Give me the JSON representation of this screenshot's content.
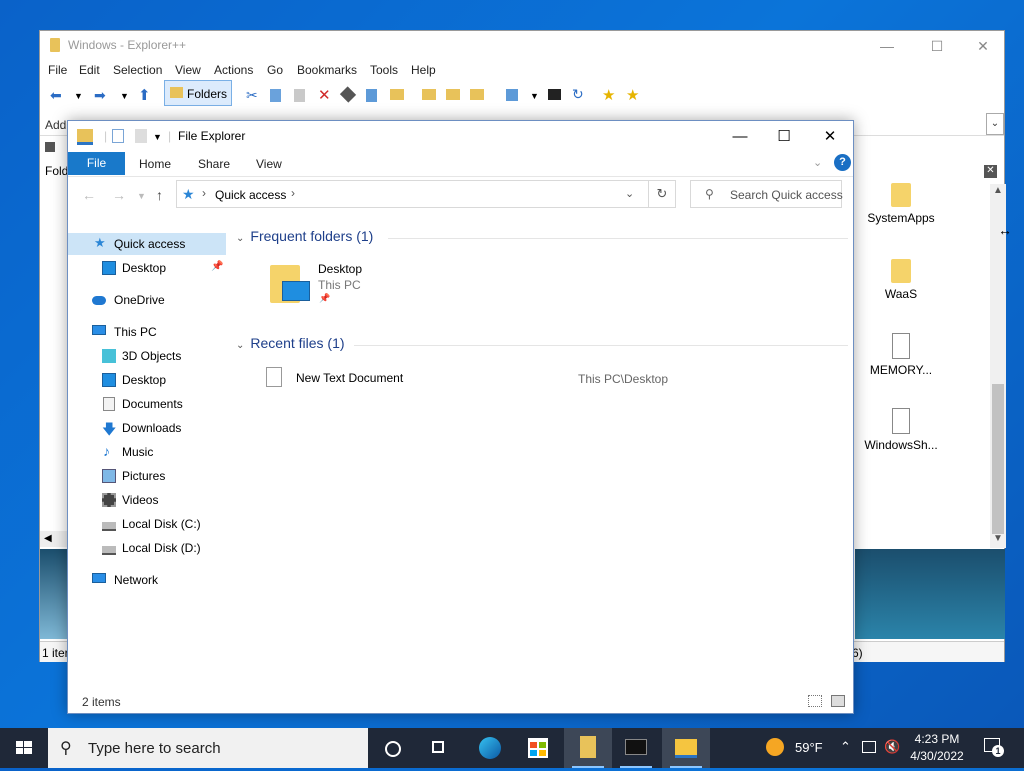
{
  "explorerpp": {
    "title": "Windows - Explorer++",
    "menu": [
      "File",
      "Edit",
      "Selection",
      "View",
      "Actions",
      "Go",
      "Bookmarks",
      "Tools",
      "Help"
    ],
    "folders_button": "Folders",
    "address_label": "Add",
    "tree_label": "Fold",
    "items": [
      "SystemApps",
      "WaaS",
      "MEMORY...",
      "WindowsSh..."
    ],
    "status_left": "1 iter",
    "status_right": "6)"
  },
  "file_explorer": {
    "title": "File Explorer",
    "ribbon": {
      "file": "File",
      "tabs": [
        "Home",
        "Share",
        "View"
      ],
      "help": "?"
    },
    "address": {
      "path": "Quick access",
      "search_placeholder": "Search Quick access"
    },
    "nav": [
      {
        "label": "Quick access",
        "icon": "star-icon"
      },
      {
        "label": "Desktop",
        "icon": "desktop-icon",
        "pinned": true
      },
      {
        "label": "OneDrive",
        "icon": "cloud-icon"
      },
      {
        "label": "This PC",
        "icon": "computer-icon"
      },
      {
        "label": "3D Objects",
        "icon": "cube-icon"
      },
      {
        "label": "Desktop",
        "icon": "desktop-icon"
      },
      {
        "label": "Documents",
        "icon": "document-icon"
      },
      {
        "label": "Downloads",
        "icon": "download-icon"
      },
      {
        "label": "Music",
        "icon": "music-icon"
      },
      {
        "label": "Pictures",
        "icon": "pictures-icon"
      },
      {
        "label": "Videos",
        "icon": "video-icon"
      },
      {
        "label": "Local Disk (C:)",
        "icon": "drive-icon"
      },
      {
        "label": "Local Disk (D:)",
        "icon": "drive-icon"
      },
      {
        "label": "Network",
        "icon": "network-icon"
      }
    ],
    "frequent_header": "Frequent folders (1)",
    "frequent": [
      {
        "name": "Desktop",
        "location": "This PC"
      }
    ],
    "recent_header": "Recent files (1)",
    "recent": [
      {
        "name": "New Text Document",
        "path": "This PC\\Desktop"
      }
    ],
    "status": "2 items"
  },
  "taskbar": {
    "search_placeholder": "Type here to search",
    "weather": "59°F",
    "time": "4:23 PM",
    "date": "4/30/2022",
    "notification_count": "1"
  }
}
